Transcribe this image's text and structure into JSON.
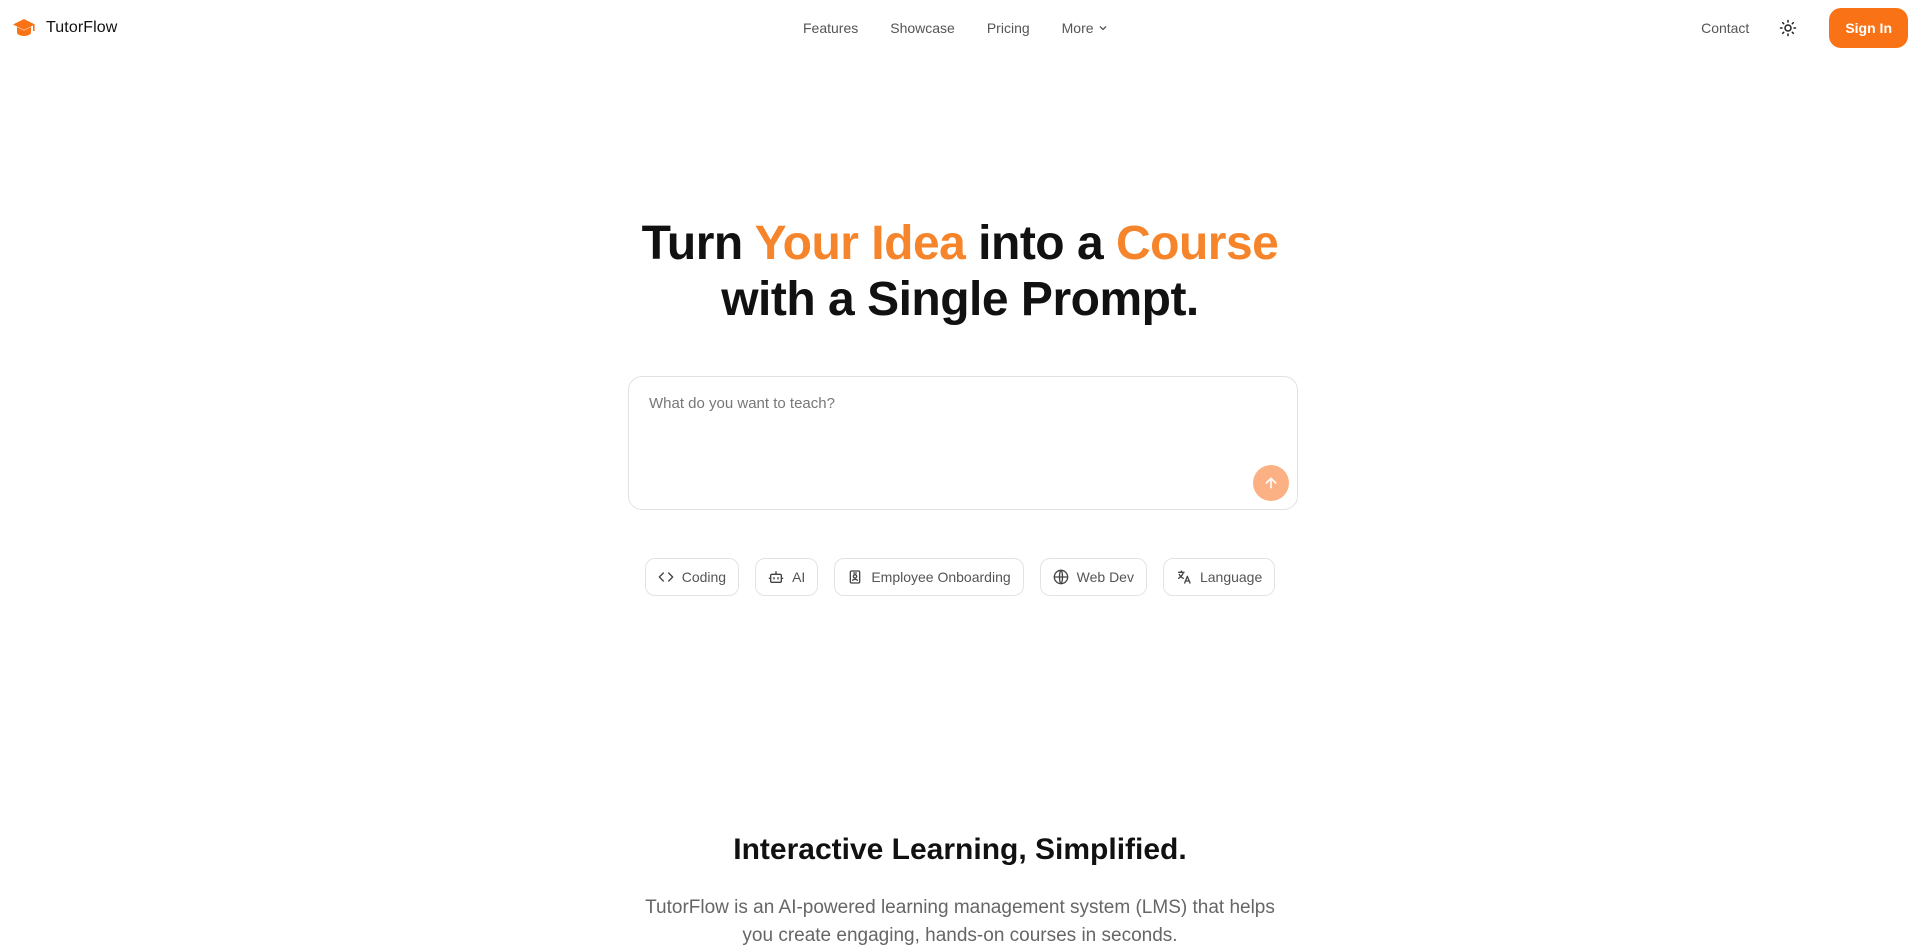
{
  "brand": {
    "name": "TutorFlow",
    "icon": "graduation-cap-icon",
    "color": "#f97316"
  },
  "nav": {
    "items": [
      {
        "label": "Features"
      },
      {
        "label": "Showcase"
      },
      {
        "label": "Pricing"
      },
      {
        "label": "More"
      }
    ]
  },
  "header_right": {
    "contact": "Contact",
    "theme_icon": "sun-icon",
    "signin": "Sign In"
  },
  "hero": {
    "t1": "Turn ",
    "t2": "Your Idea",
    "t3": " into a ",
    "t4": "Course",
    "t5": "with a Single Prompt.",
    "accent_color": "#f5842a"
  },
  "prompt": {
    "placeholder": "What do you want to teach?",
    "value": "",
    "send_icon": "arrow-up-icon"
  },
  "chips": [
    {
      "label": "Coding",
      "icon": "code-icon"
    },
    {
      "label": "AI",
      "icon": "bot-icon"
    },
    {
      "label": "Employee Onboarding",
      "icon": "id-badge-icon"
    },
    {
      "label": "Web Dev",
      "icon": "globe-icon"
    },
    {
      "label": "Language",
      "icon": "translate-icon"
    }
  ],
  "section": {
    "title": "Interactive Learning, Simplified.",
    "desc_line1": "TutorFlow is an AI-powered learning management system (LMS) that helps",
    "desc_line2": "you create engaging, hands-on courses in seconds."
  }
}
